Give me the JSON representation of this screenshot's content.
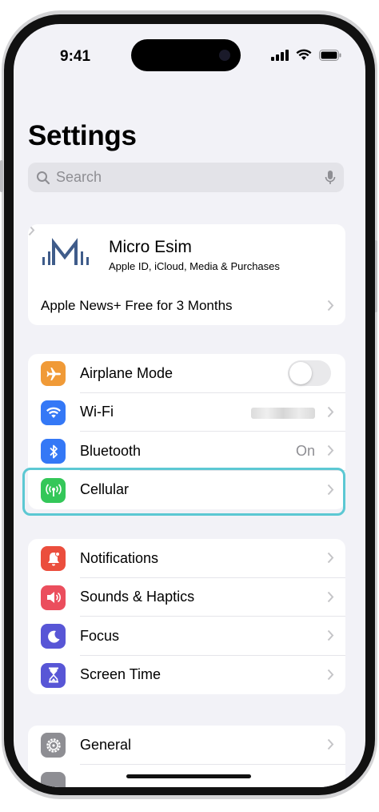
{
  "status_bar": {
    "time": "9:41"
  },
  "title": "Settings",
  "search": {
    "placeholder": "Search"
  },
  "account": {
    "name": "Micro Esim",
    "subtitle": "Apple ID, iCloud, Media & Purchases",
    "promo": "Apple News+ Free for 3 Months"
  },
  "connectivity": [
    {
      "label": "Airplane Mode",
      "icon": "airplane-icon",
      "color": "#f09a37",
      "toggle": false
    },
    {
      "label": "Wi-Fi",
      "icon": "wifi-icon",
      "color": "#3478f6",
      "value_hidden": true
    },
    {
      "label": "Bluetooth",
      "icon": "bluetooth-icon",
      "color": "#3478f6",
      "value": "On"
    },
    {
      "label": "Cellular",
      "icon": "antenna-icon",
      "color": "#34c759",
      "highlighted": true
    }
  ],
  "notifications_group": [
    {
      "label": "Notifications",
      "icon": "bell-icon",
      "color": "#eb4e3d"
    },
    {
      "label": "Sounds & Haptics",
      "icon": "speaker-icon",
      "color": "#eb4e5d"
    },
    {
      "label": "Focus",
      "icon": "moon-icon",
      "color": "#5856d6"
    },
    {
      "label": "Screen Time",
      "icon": "hourglass-icon",
      "color": "#5856d6"
    }
  ],
  "general_group": [
    {
      "label": "General",
      "icon": "gear-icon",
      "color": "#8e8e93"
    }
  ],
  "highlight_color": "#5cc8d3"
}
